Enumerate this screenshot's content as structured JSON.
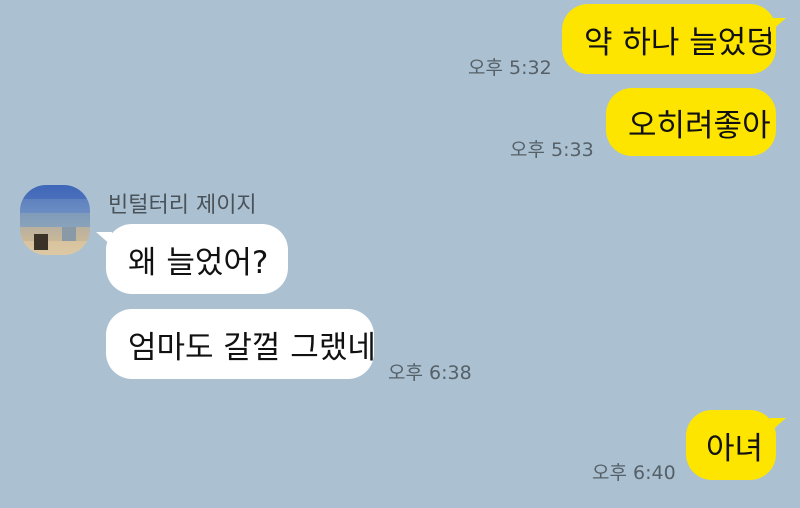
{
  "chat": {
    "sender_name": "빈털터리 제이지",
    "messages": [
      {
        "text": "약 하나 늘었덩",
        "time": "오후 5:32",
        "from": "me"
      },
      {
        "text": "오히려좋아",
        "time": "오후 5:33",
        "from": "me"
      },
      {
        "text": "왜 늘었어?",
        "time": "",
        "from": "other"
      },
      {
        "text": "엄마도 갈껄 그랬네",
        "time": "오후 6:38",
        "from": "other"
      },
      {
        "text": "아녀",
        "time": "오후 6:40",
        "from": "me"
      }
    ]
  },
  "colors": {
    "background": "#abc1d1",
    "my_bubble": "#fee500",
    "their_bubble": "#ffffff"
  }
}
